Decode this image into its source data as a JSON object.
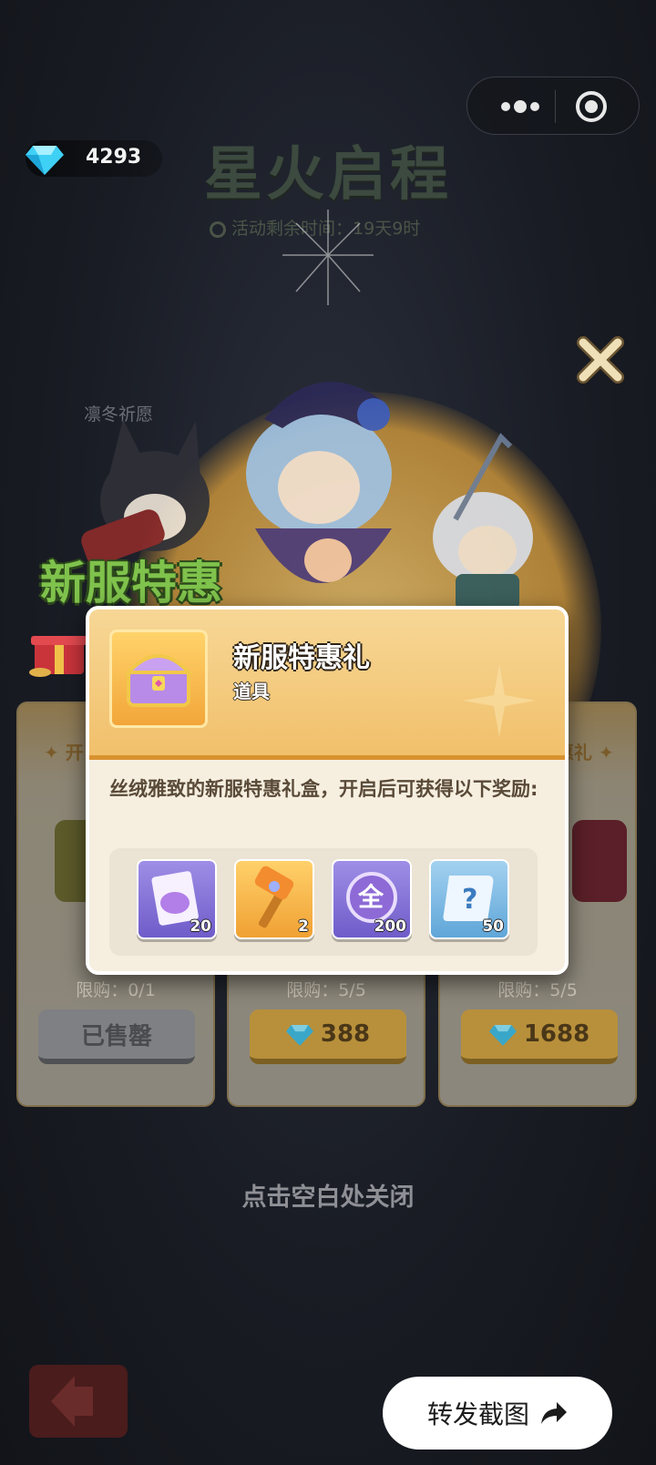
{
  "currency": {
    "gems": "4293"
  },
  "event": {
    "title": "星火启程",
    "timer_label": "活动剩余时间：",
    "timer_value": "19天9时"
  },
  "background": {
    "side_label": "凛冬祈愿",
    "promo_title": "新服特惠"
  },
  "capsule": {
    "more_icon": "more-dots-icon",
    "close_icon": "target-circle-icon"
  },
  "cards": [
    {
      "tab_fragment": "开",
      "limit": "限购：0/1",
      "button": "已售罄",
      "state": "sold_out"
    },
    {
      "limit": "限购：5/5",
      "price": "388",
      "state": "available"
    },
    {
      "tab_fragment": "惠礼",
      "limit": "限购：5/5",
      "price": "1688",
      "state": "available"
    }
  ],
  "popup": {
    "item_name": "新服特惠礼",
    "item_type": "道具",
    "description": "丝绒雅致的新服特惠礼盒，开启后可获得以下奖励:",
    "rewards": [
      {
        "icon": "ticket-icon",
        "qty": "20"
      },
      {
        "icon": "hammer-icon",
        "qty": "2"
      },
      {
        "icon": "all-coin-icon",
        "label": "全",
        "qty": "200"
      },
      {
        "icon": "mystery-scroll-icon",
        "qty": "50"
      }
    ]
  },
  "hint": "点击空白处关闭",
  "share": {
    "label": "转发截图"
  },
  "colors": {
    "accent_gold": "#f1c06b",
    "popup_bg": "#f6efe0",
    "promo_green": "#7fc24c"
  }
}
